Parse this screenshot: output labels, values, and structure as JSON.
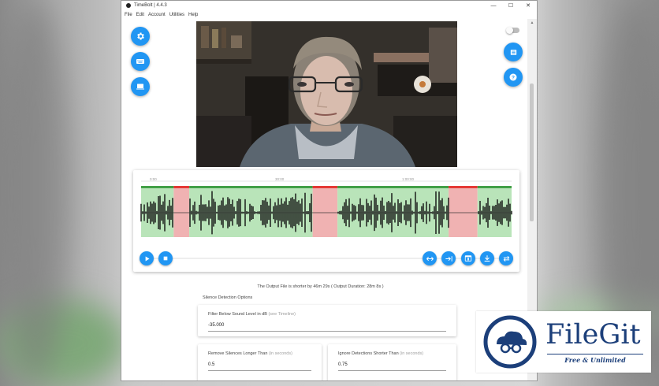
{
  "window": {
    "title": "TimeBolt | 4.4.3",
    "controls": [
      "—",
      "☐",
      "✕"
    ]
  },
  "menu": [
    "File",
    "Edit",
    "Account",
    "Utilities",
    "Help"
  ],
  "left_buttons": [
    "gear-icon",
    "keyboard-icon",
    "laptop-icon"
  ],
  "right_buttons": [
    "list-icon",
    "help-icon"
  ],
  "toggle": {
    "state": "off"
  },
  "timeline": {
    "ticks": [
      "0:00",
      "30:00",
      "1:00:00"
    ],
    "segments": [
      {
        "type": "keep",
        "start": 0.0,
        "end": 0.088
      },
      {
        "type": "cut",
        "start": 0.088,
        "end": 0.13
      },
      {
        "type": "keep",
        "start": 0.13,
        "end": 0.463
      },
      {
        "type": "cut",
        "start": 0.463,
        "end": 0.53
      },
      {
        "type": "keep",
        "start": 0.53,
        "end": 0.83
      },
      {
        "type": "cut",
        "start": 0.83,
        "end": 0.908
      },
      {
        "type": "keep",
        "start": 0.908,
        "end": 1.0
      }
    ],
    "scroll_position": 0.04
  },
  "transport": {
    "left": [
      "play-icon",
      "stop-icon"
    ],
    "right": [
      "fit-icon",
      "jump-end-icon",
      "export-icon",
      "download-icon",
      "swap-icon"
    ]
  },
  "notice": "The Output File is shorter by 46m 29s ( Output Duration: 28m 8s )",
  "section_label": "Silence Detection Options",
  "fields": {
    "filter": {
      "label": "Filter Below Sound Level in dB",
      "hint": "(see Timeline)",
      "value": "-35.000"
    },
    "remove": {
      "label": "Remove Silences Longer Than",
      "hint": "(in seconds)",
      "value": "0.5"
    },
    "ignore": {
      "label": "Ignore Detections Shorter Than",
      "hint": "(in seconds)",
      "value": "0.75"
    }
  },
  "colors": {
    "accent": "#2196f3",
    "keep_fill": "#b9e4b9",
    "cut_fill": "#f0b2b2",
    "keep_bar": "#43a047",
    "cut_bar": "#e53935"
  },
  "watermark": {
    "brand": "FileGit",
    "tagline": "Free & Unlimited"
  }
}
